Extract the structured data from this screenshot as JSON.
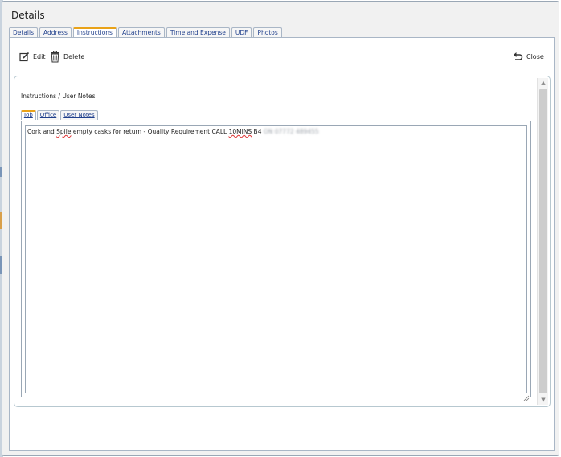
{
  "dialog": {
    "title": "Details"
  },
  "tabs": [
    {
      "label": "Details"
    },
    {
      "label": "Address"
    },
    {
      "label": "Instructions",
      "active": true
    },
    {
      "label": "Attachments"
    },
    {
      "label": "Time and Expense"
    },
    {
      "label": "UDF"
    },
    {
      "label": "Photos"
    }
  ],
  "toolbar": {
    "edit_label": "Edit",
    "delete_label": "Delete",
    "close_label": "Close"
  },
  "panel": {
    "heading": "Instructions / User Notes",
    "tabs": [
      {
        "label": "Job",
        "active": true
      },
      {
        "label": "Office"
      },
      {
        "label": "User Notes"
      }
    ],
    "notes": {
      "text_part1": "Cork and ",
      "text_spile": "Spile",
      "text_part2": " empty casks for return - Quality Requirement CALL ",
      "text_10mins": "10MINS",
      "text_part3": " B4 ",
      "text_redacted": "ON 07772 489455"
    }
  },
  "colors": {
    "tab_active_accent": "#e9a218",
    "tab_text": "#1f3f8c",
    "border": "#a9b6c6"
  }
}
